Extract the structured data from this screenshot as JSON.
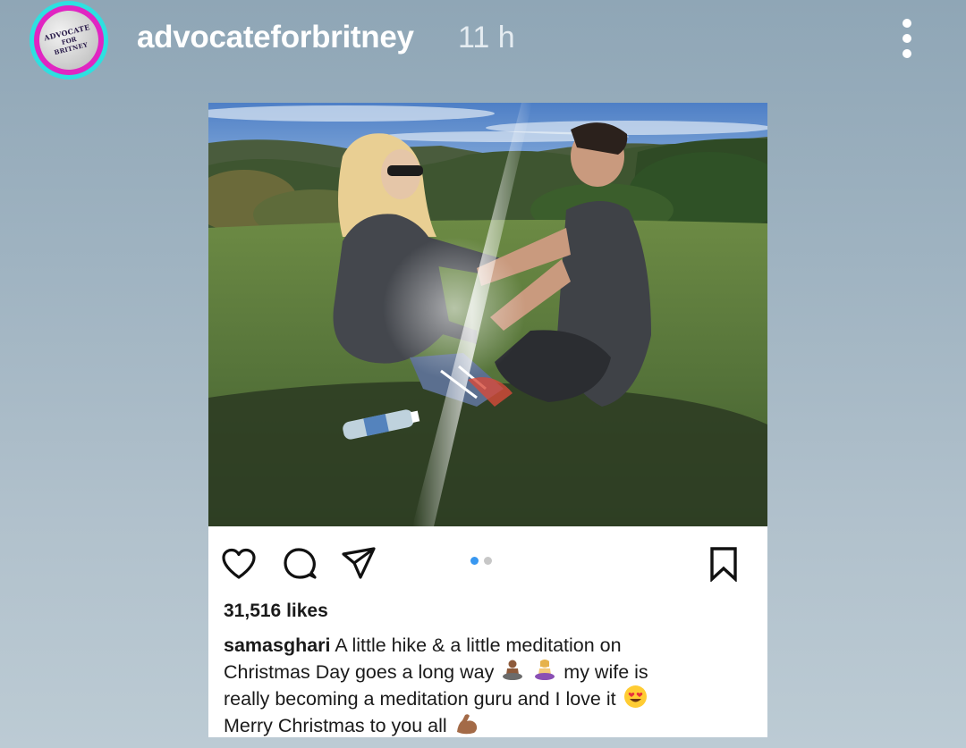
{
  "story": {
    "avatar_text": [
      "ADVOCATE",
      "FOR",
      "BRITNEY"
    ],
    "username": "advocateforbritney",
    "time": "11 h",
    "more_icon": "vertical-ellipsis-icon"
  },
  "post": {
    "image_alt": "Couple sitting on a grassy hillside facing each other in the sun",
    "likes": "31,516 likes",
    "carousel": {
      "total": 2,
      "active": 1
    },
    "caption": {
      "user": "samasghari",
      "line1": "A little hike & a little meditation on",
      "line2_a": "Christmas Day goes a long way",
      "line2_b": "my wife is",
      "line3_a": "really becoming a meditation guru and I love it",
      "line4_a": "Merry Christmas to you all",
      "emojis": [
        "person-meditating-emoji",
        "woman-meditating-emoji",
        "heart-eyes-emoji",
        "flexed-biceps-emoji"
      ]
    },
    "icons": [
      "heart-icon",
      "comment-icon",
      "share-icon",
      "bookmark-icon"
    ]
  },
  "colors": {
    "ring_outer": "#2ee0e0",
    "ring_inner": "#e025c2",
    "carousel_active": "#3897f0",
    "carousel_inactive": "#c7c7c7"
  }
}
